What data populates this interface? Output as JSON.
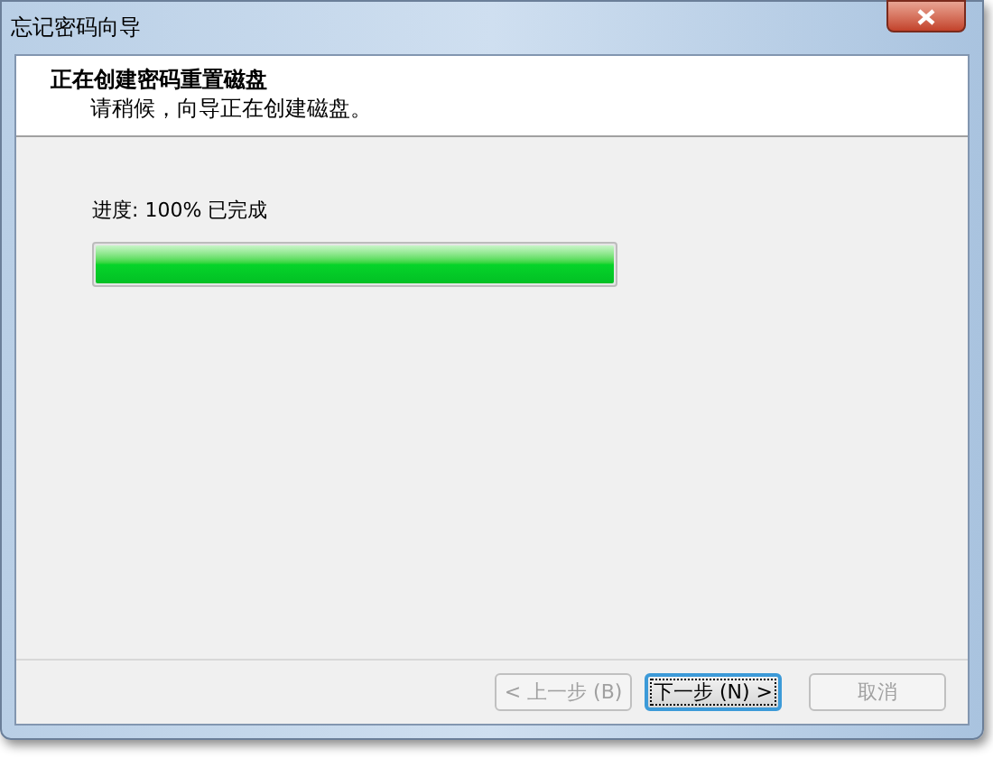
{
  "window": {
    "title": "忘记密码向导"
  },
  "header": {
    "title": "正在创建密码重置磁盘",
    "subtitle": "请稍候，向导正在创建磁盘。"
  },
  "progress": {
    "label": "进度: 100% 已完成",
    "level": 1.0
  },
  "buttons": [
    {
      "label": "< 上一步 (B)",
      "disabled": true,
      "focused": false
    },
    {
      "label": "下一步 (N) >",
      "disabled": false,
      "focused": true
    },
    {
      "label": "取消",
      "disabled": true,
      "focused": false
    }
  ]
}
